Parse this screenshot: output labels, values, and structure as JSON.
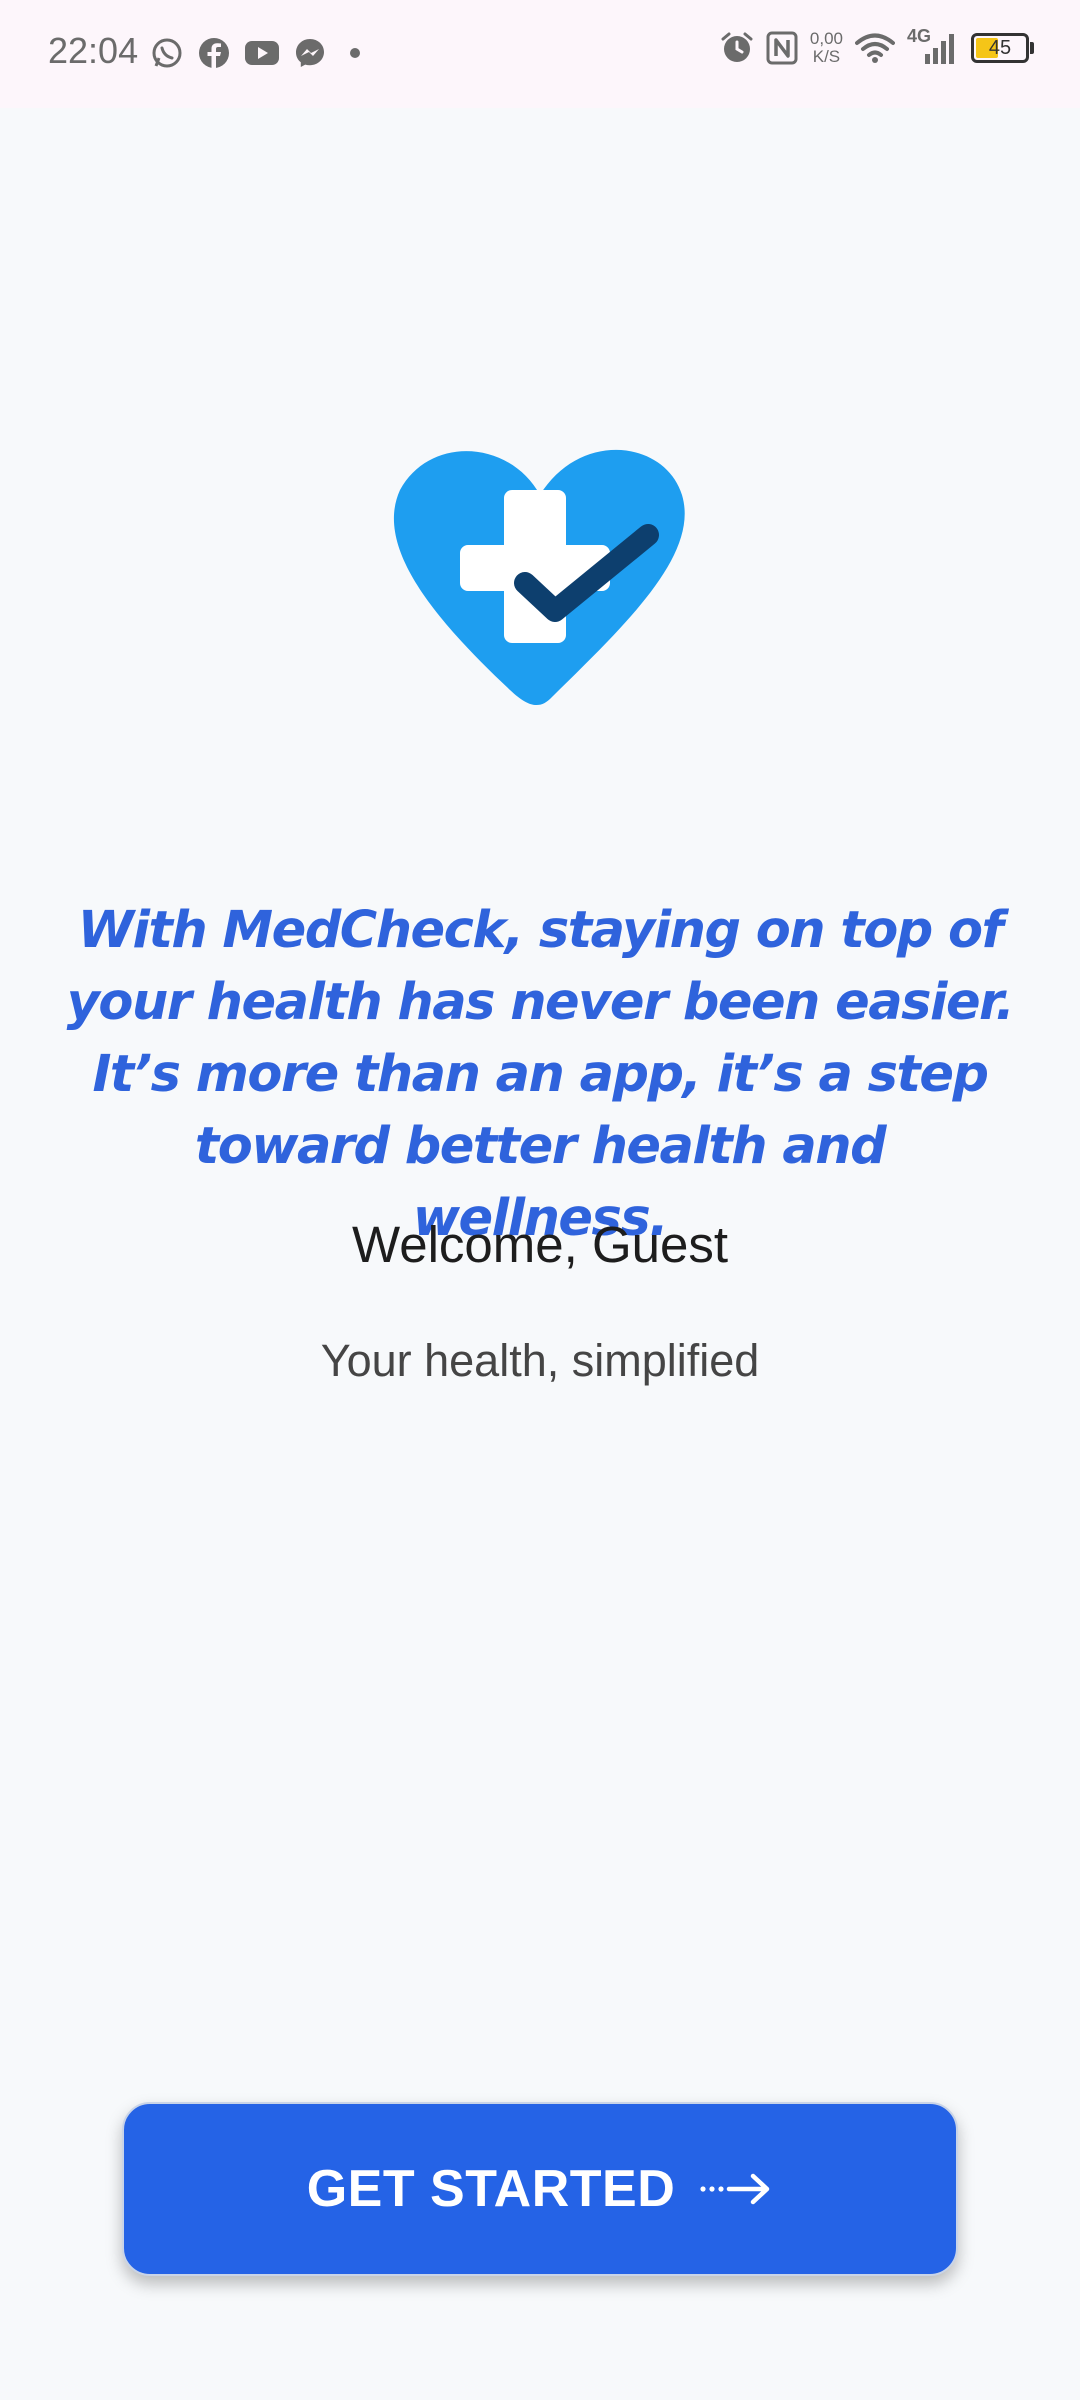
{
  "status_bar": {
    "time": "22:04",
    "net_speed_value": "0,00",
    "net_speed_unit": "K/S",
    "network_type": "4G",
    "battery_level": "45",
    "battery_fraction": 0.45,
    "left_icons": [
      "whatsapp-icon",
      "facebook-icon",
      "youtube-icon",
      "messenger-icon",
      "dot-icon"
    ],
    "right_icons": [
      "alarm-icon",
      "nfc-icon",
      "wifi-icon",
      "signal-icon",
      "battery-icon"
    ]
  },
  "brand": {
    "logo_icon": "heart-cross-check-icon",
    "colors": {
      "heart": "#1e9ef0",
      "check": "#0d3f6e",
      "accent_text": "#2f63dc",
      "button": "#2563e6"
    }
  },
  "main": {
    "tagline": "With MedCheck, staying on top of your health has never been easier. It’s more than an app, it’s a step toward better health and wellness.",
    "welcome": "Welcome, Guest",
    "subtitle": "Your health, simplified"
  },
  "cta": {
    "label": "GET STARTED",
    "icon": "arrow-right-icon"
  }
}
